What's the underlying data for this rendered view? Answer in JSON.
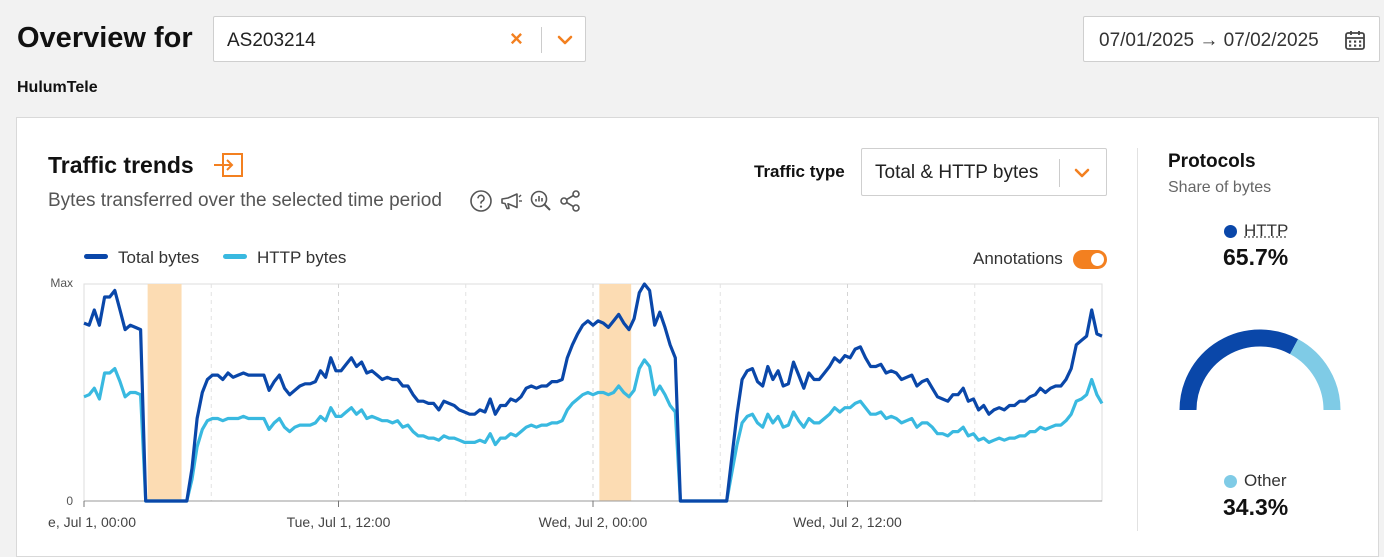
{
  "header": {
    "title": "Overview for",
    "asn_value": "AS203214",
    "clear_glyph": "×",
    "network_name": "HulumTele",
    "date_range": "07/01/2025 → 07/02/2025"
  },
  "traffic_trends": {
    "title": "Traffic trends",
    "subtitle": "Bytes transferred over the selected time period",
    "traffic_type_label": "Traffic type",
    "traffic_type_value": "Total & HTTP bytes",
    "annotations_label": "Annotations",
    "annotations_enabled": true,
    "icons": [
      "help-icon",
      "megaphone-icon",
      "zoom-chart-icon",
      "share-icon"
    ]
  },
  "chart_data": {
    "type": "line",
    "y_tick_labels": [
      "Max",
      "0"
    ],
    "x_tick_labels": [
      "e, Jul 1, 00:00",
      "Tue, Jul 1, 12:00",
      "Wed, Jul 2, 00:00",
      "Wed, Jul 2, 12:00"
    ],
    "x_range_hours": [
      0,
      48
    ],
    "ylim": [
      0,
      1
    ],
    "grid": true,
    "legend_position": "top-left",
    "outage_annotations_hours": [
      [
        3.0,
        4.6
      ],
      [
        24.3,
        25.8
      ]
    ],
    "series": [
      {
        "name": "Total bytes",
        "color": "#0a47a9",
        "values": [
          0.82,
          0.81,
          0.88,
          0.81,
          0.94,
          0.94,
          0.97,
          0.88,
          0.79,
          0.81,
          0.8,
          0.79,
          0,
          0,
          0,
          0,
          0,
          0,
          0,
          0,
          0,
          0.15,
          0.38,
          0.5,
          0.56,
          0.58,
          0.58,
          0.56,
          0.59,
          0.57,
          0.58,
          0.59,
          0.58,
          0.58,
          0.58,
          0.58,
          0.51,
          0.55,
          0.58,
          0.52,
          0.49,
          0.51,
          0.53,
          0.54,
          0.54,
          0.55,
          0.6,
          0.57,
          0.66,
          0.6,
          0.6,
          0.63,
          0.66,
          0.62,
          0.64,
          0.59,
          0.6,
          0.58,
          0.56,
          0.57,
          0.56,
          0.56,
          0.53,
          0.53,
          0.49,
          0.46,
          0.46,
          0.45,
          0.45,
          0.42,
          0.46,
          0.45,
          0.44,
          0.42,
          0.41,
          0.4,
          0.4,
          0.42,
          0.41,
          0.47,
          0.4,
          0.44,
          0.44,
          0.47,
          0.46,
          0.48,
          0.52,
          0.53,
          0.52,
          0.53,
          0.53,
          0.55,
          0.55,
          0.56,
          0.66,
          0.72,
          0.77,
          0.81,
          0.83,
          0.81,
          0.83,
          0.82,
          0.8,
          0.83,
          0.86,
          0.82,
          0.79,
          0.84,
          0.96,
          1.0,
          0.97,
          0.81,
          0.87,
          0.8,
          0.72,
          0.66,
          0,
          0,
          0,
          0,
          0,
          0,
          0,
          0,
          0,
          0,
          0.2,
          0.4,
          0.56,
          0.6,
          0.61,
          0.55,
          0.53,
          0.62,
          0.56,
          0.6,
          0.53,
          0.54,
          0.64,
          0.58,
          0.52,
          0.59,
          0.56,
          0.56,
          0.59,
          0.62,
          0.66,
          0.64,
          0.67,
          0.66,
          0.7,
          0.71,
          0.66,
          0.62,
          0.62,
          0.63,
          0.59,
          0.6,
          0.59,
          0.56,
          0.57,
          0.58,
          0.53,
          0.55,
          0.56,
          0.52,
          0.48,
          0.47,
          0.46,
          0.49,
          0.49,
          0.52,
          0.46,
          0.47,
          0.42,
          0.44,
          0.4,
          0.42,
          0.43,
          0.42,
          0.44,
          0.44,
          0.46,
          0.46,
          0.48,
          0.49,
          0.52,
          0.5,
          0.52,
          0.53,
          0.53,
          0.56,
          0.61,
          0.72,
          0.74,
          0.76,
          0.88,
          0.77,
          0.76
        ],
        "values_note_hidden": null
      },
      {
        "name": "HTTP bytes",
        "color": "#39b9e0",
        "values": [
          0.48,
          0.49,
          0.52,
          0.47,
          0.59,
          0.59,
          0.61,
          0.55,
          0.48,
          0.5,
          0.5,
          0.49,
          0,
          0,
          0,
          0,
          0,
          0,
          0,
          0,
          0,
          0.1,
          0.25,
          0.33,
          0.37,
          0.38,
          0.38,
          0.37,
          0.38,
          0.38,
          0.38,
          0.39,
          0.38,
          0.38,
          0.38,
          0.38,
          0.33,
          0.36,
          0.38,
          0.34,
          0.32,
          0.34,
          0.35,
          0.35,
          0.35,
          0.36,
          0.39,
          0.37,
          0.43,
          0.39,
          0.39,
          0.41,
          0.43,
          0.4,
          0.42,
          0.38,
          0.39,
          0.38,
          0.37,
          0.37,
          0.36,
          0.37,
          0.34,
          0.35,
          0.32,
          0.3,
          0.3,
          0.29,
          0.29,
          0.28,
          0.3,
          0.29,
          0.29,
          0.28,
          0.27,
          0.27,
          0.27,
          0.28,
          0.27,
          0.31,
          0.26,
          0.29,
          0.29,
          0.31,
          0.3,
          0.32,
          0.34,
          0.35,
          0.34,
          0.35,
          0.35,
          0.36,
          0.36,
          0.37,
          0.42,
          0.45,
          0.47,
          0.49,
          0.5,
          0.49,
          0.5,
          0.5,
          0.49,
          0.5,
          0.53,
          0.5,
          0.48,
          0.51,
          0.61,
          0.65,
          0.62,
          0.49,
          0.53,
          0.49,
          0.44,
          0.41,
          0,
          0,
          0,
          0,
          0,
          0,
          0,
          0,
          0,
          0,
          0.13,
          0.26,
          0.36,
          0.39,
          0.4,
          0.36,
          0.34,
          0.4,
          0.36,
          0.39,
          0.34,
          0.35,
          0.41,
          0.37,
          0.34,
          0.38,
          0.36,
          0.36,
          0.38,
          0.4,
          0.43,
          0.41,
          0.43,
          0.43,
          0.45,
          0.46,
          0.43,
          0.4,
          0.4,
          0.41,
          0.38,
          0.39,
          0.38,
          0.36,
          0.37,
          0.38,
          0.34,
          0.36,
          0.36,
          0.34,
          0.31,
          0.31,
          0.3,
          0.32,
          0.32,
          0.34,
          0.3,
          0.31,
          0.28,
          0.29,
          0.27,
          0.28,
          0.29,
          0.28,
          0.29,
          0.29,
          0.3,
          0.3,
          0.32,
          0.32,
          0.34,
          0.33,
          0.34,
          0.35,
          0.35,
          0.37,
          0.4,
          0.46,
          0.47,
          0.49,
          0.56,
          0.49,
          0.45
        ]
      }
    ]
  },
  "protocols": {
    "title": "Protocols",
    "subtitle": "Share of bytes",
    "items": [
      {
        "name": "HTTP",
        "percent_label": "65.7%",
        "value": 65.7,
        "color": "#0a47a9"
      },
      {
        "name": "Other",
        "percent_label": "34.3%",
        "value": 34.3,
        "color": "#7fcbe6"
      }
    ]
  },
  "colors": {
    "accent": "#f38020",
    "outage_band": "#fcdcb3"
  }
}
